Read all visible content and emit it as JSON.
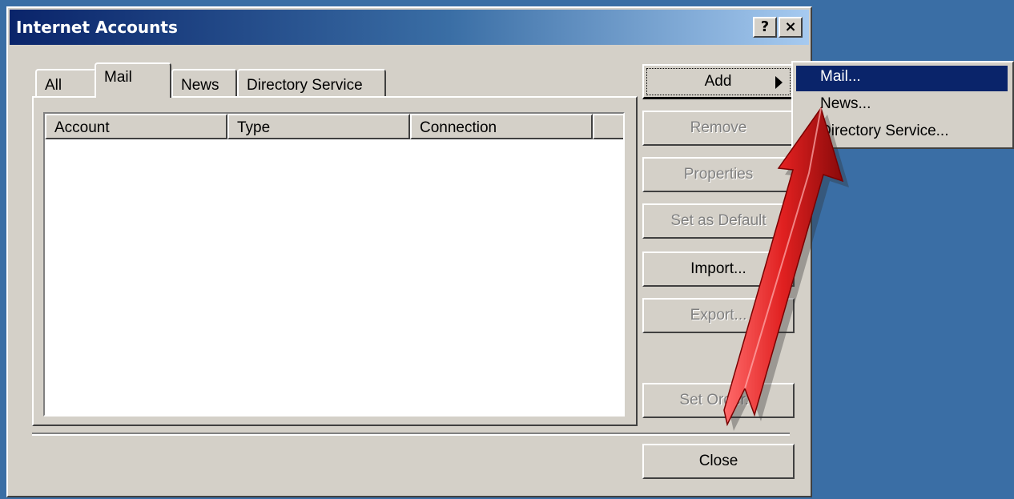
{
  "window": {
    "title": "Internet Accounts",
    "help_button": "?",
    "close_button": "×"
  },
  "tabs": [
    {
      "label": "All"
    },
    {
      "label": "Mail"
    },
    {
      "label": "News"
    },
    {
      "label": "Directory Service"
    }
  ],
  "active_tab": "Mail",
  "list": {
    "columns": [
      {
        "label": "Account"
      },
      {
        "label": "Type"
      },
      {
        "label": "Connection"
      },
      {
        "label": ""
      }
    ]
  },
  "buttons": {
    "add": "Add",
    "remove": "Remove",
    "properties": "Properties",
    "set_default": "Set as Default",
    "import": "Import...",
    "export": "Export...",
    "set_order": "Set Order...",
    "close": "Close"
  },
  "add_menu": {
    "items": [
      {
        "label": "Mail..."
      },
      {
        "label": "News..."
      },
      {
        "label": "Directory Service..."
      }
    ]
  },
  "colors": {
    "desktop": "#3a6ea5",
    "face": "#d4d0c8",
    "title_start": "#0a246a",
    "highlight": "#0a246a",
    "arrow": "#e02020"
  }
}
